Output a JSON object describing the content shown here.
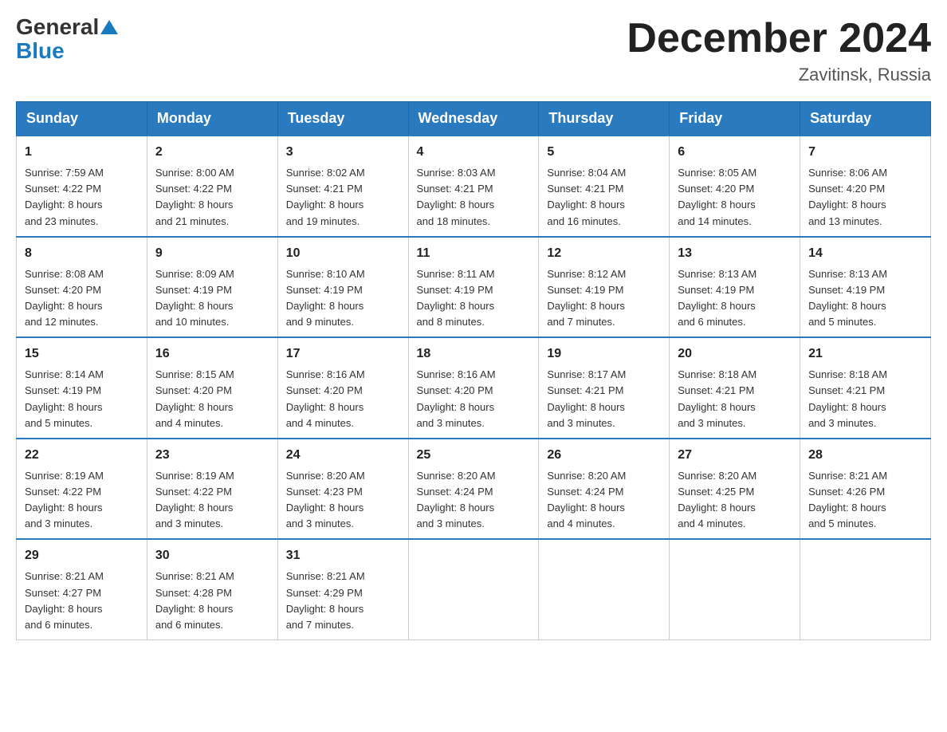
{
  "header": {
    "logo_general": "General",
    "logo_blue": "Blue",
    "month_title": "December 2024",
    "location": "Zavitinsk, Russia"
  },
  "weekdays": [
    "Sunday",
    "Monday",
    "Tuesday",
    "Wednesday",
    "Thursday",
    "Friday",
    "Saturday"
  ],
  "weeks": [
    [
      {
        "day": "1",
        "sunrise": "7:59 AM",
        "sunset": "4:22 PM",
        "daylight": "8 hours and 23 minutes."
      },
      {
        "day": "2",
        "sunrise": "8:00 AM",
        "sunset": "4:22 PM",
        "daylight": "8 hours and 21 minutes."
      },
      {
        "day": "3",
        "sunrise": "8:02 AM",
        "sunset": "4:21 PM",
        "daylight": "8 hours and 19 minutes."
      },
      {
        "day": "4",
        "sunrise": "8:03 AM",
        "sunset": "4:21 PM",
        "daylight": "8 hours and 18 minutes."
      },
      {
        "day": "5",
        "sunrise": "8:04 AM",
        "sunset": "4:21 PM",
        "daylight": "8 hours and 16 minutes."
      },
      {
        "day": "6",
        "sunrise": "8:05 AM",
        "sunset": "4:20 PM",
        "daylight": "8 hours and 14 minutes."
      },
      {
        "day": "7",
        "sunrise": "8:06 AM",
        "sunset": "4:20 PM",
        "daylight": "8 hours and 13 minutes."
      }
    ],
    [
      {
        "day": "8",
        "sunrise": "8:08 AM",
        "sunset": "4:20 PM",
        "daylight": "8 hours and 12 minutes."
      },
      {
        "day": "9",
        "sunrise": "8:09 AM",
        "sunset": "4:19 PM",
        "daylight": "8 hours and 10 minutes."
      },
      {
        "day": "10",
        "sunrise": "8:10 AM",
        "sunset": "4:19 PM",
        "daylight": "8 hours and 9 minutes."
      },
      {
        "day": "11",
        "sunrise": "8:11 AM",
        "sunset": "4:19 PM",
        "daylight": "8 hours and 8 minutes."
      },
      {
        "day": "12",
        "sunrise": "8:12 AM",
        "sunset": "4:19 PM",
        "daylight": "8 hours and 7 minutes."
      },
      {
        "day": "13",
        "sunrise": "8:13 AM",
        "sunset": "4:19 PM",
        "daylight": "8 hours and 6 minutes."
      },
      {
        "day": "14",
        "sunrise": "8:13 AM",
        "sunset": "4:19 PM",
        "daylight": "8 hours and 5 minutes."
      }
    ],
    [
      {
        "day": "15",
        "sunrise": "8:14 AM",
        "sunset": "4:19 PM",
        "daylight": "8 hours and 5 minutes."
      },
      {
        "day": "16",
        "sunrise": "8:15 AM",
        "sunset": "4:20 PM",
        "daylight": "8 hours and 4 minutes."
      },
      {
        "day": "17",
        "sunrise": "8:16 AM",
        "sunset": "4:20 PM",
        "daylight": "8 hours and 4 minutes."
      },
      {
        "day": "18",
        "sunrise": "8:16 AM",
        "sunset": "4:20 PM",
        "daylight": "8 hours and 3 minutes."
      },
      {
        "day": "19",
        "sunrise": "8:17 AM",
        "sunset": "4:21 PM",
        "daylight": "8 hours and 3 minutes."
      },
      {
        "day": "20",
        "sunrise": "8:18 AM",
        "sunset": "4:21 PM",
        "daylight": "8 hours and 3 minutes."
      },
      {
        "day": "21",
        "sunrise": "8:18 AM",
        "sunset": "4:21 PM",
        "daylight": "8 hours and 3 minutes."
      }
    ],
    [
      {
        "day": "22",
        "sunrise": "8:19 AM",
        "sunset": "4:22 PM",
        "daylight": "8 hours and 3 minutes."
      },
      {
        "day": "23",
        "sunrise": "8:19 AM",
        "sunset": "4:22 PM",
        "daylight": "8 hours and 3 minutes."
      },
      {
        "day": "24",
        "sunrise": "8:20 AM",
        "sunset": "4:23 PM",
        "daylight": "8 hours and 3 minutes."
      },
      {
        "day": "25",
        "sunrise": "8:20 AM",
        "sunset": "4:24 PM",
        "daylight": "8 hours and 3 minutes."
      },
      {
        "day": "26",
        "sunrise": "8:20 AM",
        "sunset": "4:24 PM",
        "daylight": "8 hours and 4 minutes."
      },
      {
        "day": "27",
        "sunrise": "8:20 AM",
        "sunset": "4:25 PM",
        "daylight": "8 hours and 4 minutes."
      },
      {
        "day": "28",
        "sunrise": "8:21 AM",
        "sunset": "4:26 PM",
        "daylight": "8 hours and 5 minutes."
      }
    ],
    [
      {
        "day": "29",
        "sunrise": "8:21 AM",
        "sunset": "4:27 PM",
        "daylight": "8 hours and 6 minutes."
      },
      {
        "day": "30",
        "sunrise": "8:21 AM",
        "sunset": "4:28 PM",
        "daylight": "8 hours and 6 minutes."
      },
      {
        "day": "31",
        "sunrise": "8:21 AM",
        "sunset": "4:29 PM",
        "daylight": "8 hours and 7 minutes."
      },
      null,
      null,
      null,
      null
    ]
  ],
  "labels": {
    "sunrise": "Sunrise:",
    "sunset": "Sunset:",
    "daylight": "Daylight:"
  }
}
